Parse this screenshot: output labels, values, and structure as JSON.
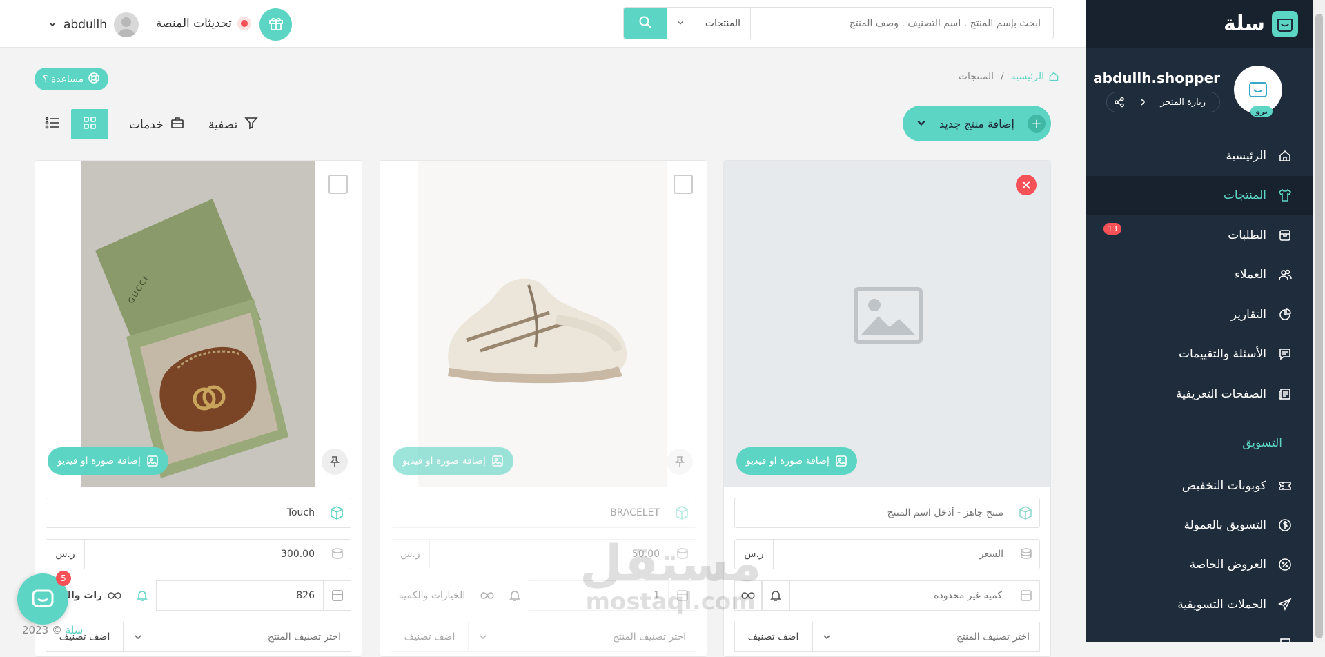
{
  "sidebar": {
    "logo_text": "سلة",
    "store_name": "abdullh.shopper",
    "store_badge": "برو",
    "visit_store_label": "زيارة المتجر",
    "nav_items": [
      {
        "label": "الرئيسية",
        "icon": "home-icon"
      },
      {
        "label": "المنتجات",
        "icon": "shirt-icon",
        "active": true
      },
      {
        "label": "الطلبات",
        "icon": "box-icon",
        "badge": "13"
      },
      {
        "label": "العملاء",
        "icon": "users-icon"
      },
      {
        "label": "التقارير",
        "icon": "pie-chart-icon"
      },
      {
        "label": "الأسئلة والتقييمات",
        "icon": "comment-icon"
      },
      {
        "label": "الصفحات التعريفية",
        "icon": "newspaper-icon"
      }
    ],
    "marketing_label": "التسويق",
    "marketing_items": [
      {
        "label": "كوبونات التخفيض",
        "icon": "ticket-icon"
      },
      {
        "label": "التسويق بالعمولة",
        "icon": "dollar-icon"
      },
      {
        "label": "العروض الخاصة",
        "icon": "discount-icon"
      },
      {
        "label": "الحملات التسويقية",
        "icon": "send-icon"
      }
    ]
  },
  "topbar": {
    "search_placeholder": "ابحث بإسم المنتج . اسم التصنيف . وصف المنتج",
    "search_category": "المنتجات",
    "updates_label": "تحديثات المنصة",
    "user_name": "abdullh"
  },
  "page": {
    "help_label": "مساعدة ؟",
    "breadcrumb_home": "الرئيسية",
    "breadcrumb_sep": "/",
    "breadcrumb_current": "المنتجات",
    "add_product_label": "إضافة منتج جديد",
    "filter_label": "تصفية",
    "services_label": "خدمات"
  },
  "cards": [
    {
      "type": "new",
      "add_media_label": "إضافة صورة او فيديو",
      "name_placeholder": "منتج جاهز - أدخل اسم المنتج",
      "price_placeholder": "السعر",
      "currency": "ر.س",
      "quantity_placeholder": "كمية غير محدودة",
      "category_placeholder": "اختر تصنيف المنتج",
      "add_category_label": "اضف تصنيف"
    },
    {
      "type": "shoe",
      "add_media_label": "إضافة صورة او فيديو",
      "name": "BRACELET",
      "price": "50.00",
      "currency": "ر.س",
      "quantity": "1",
      "options_label": "الخيارات والكمية",
      "category_placeholder": "اختر تصنيف المنتج",
      "add_category_label": "اضف تصنيف"
    },
    {
      "type": "bag",
      "add_media_label": "إضافة صورة او فيديو",
      "name": "Touch",
      "price": "300.00",
      "currency": "ر.س",
      "quantity": "826",
      "options_label": "الخيارات والكمية",
      "category_placeholder": "اختر تصنيف المنتج",
      "add_category_label": "اضف تصنيف",
      "image_brand_text": "GUCCI"
    }
  ],
  "chat_badge": "5",
  "copyright_prefix": "2023 ©",
  "copyright_brand": "سلة",
  "watermark": {
    "line1": "مستقل",
    "line2": "mostaql.com"
  },
  "colors": {
    "accent": "#5dd5c4",
    "sidebar": "#1e2c3b",
    "danger": "#f55157"
  }
}
